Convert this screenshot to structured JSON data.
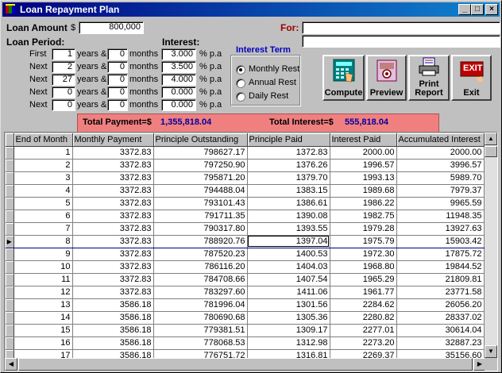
{
  "window": {
    "title": "Loan Repayment Plan",
    "controls": {
      "minimize": "_",
      "maximize": "□",
      "close": "×"
    }
  },
  "loan": {
    "amount_label": "Loan Amount",
    "currency": "$",
    "amount_value": "800,000",
    "for_label": "For:",
    "for_value": "",
    "for_value2": "",
    "period_label": "Loan Period:",
    "interest_label": "Interest:"
  },
  "periods": [
    {
      "label": "First",
      "years": "1",
      "months": "0",
      "rate": "3.000"
    },
    {
      "label": "Next",
      "years": "2",
      "months": "0",
      "rate": "3.500"
    },
    {
      "label": "Next",
      "years": "27",
      "months": "0",
      "rate": "4.000"
    },
    {
      "label": "Next",
      "years": "0",
      "months": "0",
      "rate": "0.000"
    },
    {
      "label": "Next",
      "years": "0",
      "months": "0",
      "rate": "0.000"
    }
  ],
  "period_text": {
    "years": "years &",
    "months": "months",
    "rate_unit": "% p.a"
  },
  "interest_term": {
    "title": "Interest Term",
    "options": [
      "Monthly Rest",
      "Annual Rest",
      "Daily Rest"
    ],
    "selected": "Monthly Rest"
  },
  "buttons": {
    "compute": "Compute",
    "preview": "Preview",
    "print1": "Print",
    "print2": "Report",
    "exit": "Exit",
    "exit_sign": "EXIT"
  },
  "totals": {
    "payment_label": "Total Payment=$",
    "payment_value": "1,355,818.04",
    "interest_label": "Total Interest=$",
    "interest_value": "555,818.04",
    "label_color": "#000000",
    "value_color": "#0000a0",
    "bg_color": "#f08080"
  },
  "table": {
    "headers": [
      "End of Month",
      "Monthly Payment",
      "Principle Outstanding",
      "Principle Paid",
      "Interest Paid",
      "Accumulated Interest"
    ],
    "rows": [
      [
        "1",
        "3372.83",
        "798627.17",
        "1372.83",
        "2000.00",
        "2000.00"
      ],
      [
        "2",
        "3372.83",
        "797250.90",
        "1376.26",
        "1996.57",
        "3996.57"
      ],
      [
        "3",
        "3372.83",
        "795871.20",
        "1379.70",
        "1993.13",
        "5989.70"
      ],
      [
        "4",
        "3372.83",
        "794488.04",
        "1383.15",
        "1989.68",
        "7979.37"
      ],
      [
        "5",
        "3372.83",
        "793101.43",
        "1386.61",
        "1986.22",
        "9965.59"
      ],
      [
        "6",
        "3372.83",
        "791711.35",
        "1390.08",
        "1982.75",
        "11948.35"
      ],
      [
        "7",
        "3372.83",
        "790317.80",
        "1393.55",
        "1979.28",
        "13927.63"
      ],
      [
        "8",
        "3372.83",
        "788920.76",
        "1397.04",
        "1975.79",
        "15903.42"
      ],
      [
        "9",
        "3372.83",
        "787520.23",
        "1400.53",
        "1972.30",
        "17875.72"
      ],
      [
        "10",
        "3372.83",
        "786116.20",
        "1404.03",
        "1968.80",
        "19844.52"
      ],
      [
        "11",
        "3372.83",
        "784708.66",
        "1407.54",
        "1965.29",
        "21809.81"
      ],
      [
        "12",
        "3372.83",
        "783297.60",
        "1411.06",
        "1961.77",
        "23771.58"
      ],
      [
        "13",
        "3586.18",
        "781996.04",
        "1301.56",
        "2284.62",
        "26056.20"
      ],
      [
        "14",
        "3586.18",
        "780690.68",
        "1305.36",
        "2280.82",
        "28337.02"
      ],
      [
        "15",
        "3586.18",
        "779381.51",
        "1309.17",
        "2277.01",
        "30614.04"
      ],
      [
        "16",
        "3586.18",
        "778068.53",
        "1312.98",
        "2273.20",
        "32887.23"
      ],
      [
        "17",
        "3586.18",
        "776751.72",
        "1316.81",
        "2269.37",
        "35156.60"
      ]
    ],
    "current_row": 8,
    "indicator": "▶"
  },
  "scroll": {
    "up": "▲",
    "down": "▼",
    "left": "◀",
    "right": "▶"
  }
}
